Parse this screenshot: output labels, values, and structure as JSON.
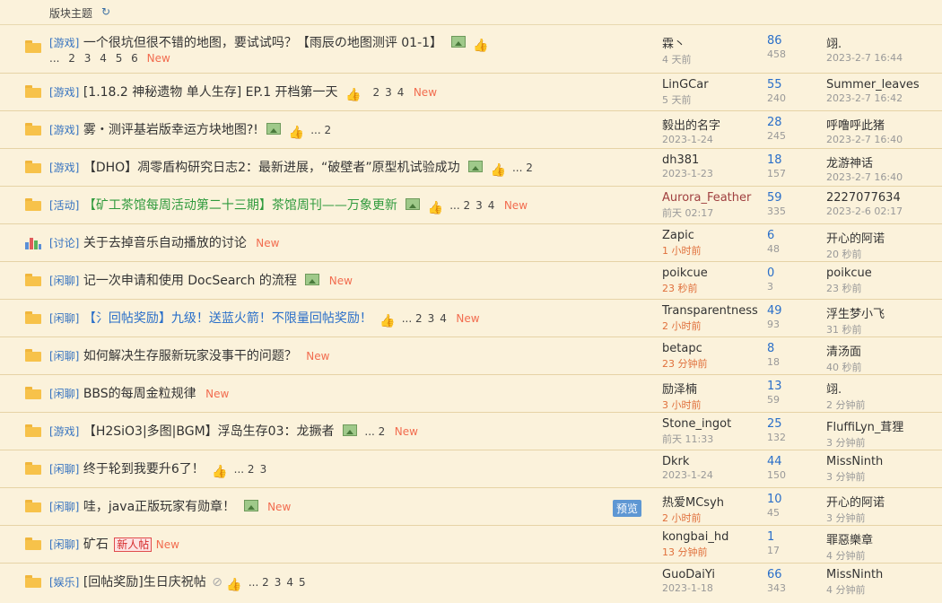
{
  "header": {
    "title": "版块主题",
    "refresh_icon": "refresh-icon"
  },
  "colors": {
    "category": "#3673c0",
    "new": "#f26c4f",
    "replies": "#2a6fc9",
    "hot_time": "#e0703c",
    "green_title": "#2f9a3c",
    "blue_title": "#2a6fc9"
  },
  "threads": [
    {
      "category": "[游戏]",
      "title": "一个很坑但很不错的地图，要试试吗？【雨辰の地图测评 01-1】",
      "pages": [
        "...",
        "2",
        "3",
        "4",
        "5",
        "6"
      ],
      "new": "New",
      "author": "霖丶",
      "author_time": "4 天前",
      "replies": "86",
      "views": "458",
      "last_user": "翊.",
      "last_time": "2023-2-7 16:44"
    },
    {
      "category": "[游戏]",
      "title": "[1.18.2 神秘遗物 单人生存] EP.1 开档第一天",
      "pages": [
        "2",
        "3",
        "4"
      ],
      "new": "New",
      "author": "LinGCar",
      "author_time": "5 天前",
      "replies": "55",
      "views": "240",
      "last_user": "Summer_leaves",
      "last_time": "2023-2-7 16:42"
    },
    {
      "category": "[游戏]",
      "title": "雾・测评基岩版幸运方块地图?!",
      "pages": [
        "2"
      ],
      "new": "",
      "author": "毅出的名字",
      "author_time": "2023-1-24",
      "replies": "28",
      "views": "245",
      "last_user": "呼噜呼此猪",
      "last_time": "2023-2-7 16:40"
    },
    {
      "category": "[游戏]",
      "title": "【DHO】凋零盾构研究日志2：最新进展，“破壁者”原型机试验成功",
      "pages": [
        "2"
      ],
      "new": "",
      "author": "dh381",
      "author_time": "2023-1-23",
      "replies": "18",
      "views": "157",
      "last_user": "龙游神话",
      "last_time": "2023-2-7 16:40"
    },
    {
      "category": "[活动]",
      "title": "【矿工茶馆每周活动第二十三期】茶馆周刊——万象更新",
      "pages": [
        "2",
        "3",
        "4"
      ],
      "new": "New",
      "author": "Aurora_Feather",
      "author_time": "前天 02:17",
      "replies": "59",
      "views": "335",
      "last_user": "2227077634",
      "last_time": "2023-2-6 02:17"
    },
    {
      "category": "[讨论]",
      "title": "关于去掉音乐自动播放的讨论",
      "pages": [],
      "new": "New",
      "author": "Zapic",
      "author_time": "1 小时前",
      "replies": "6",
      "views": "48",
      "last_user": "开心的阿诺",
      "last_time": "20 秒前"
    },
    {
      "category": "[闲聊]",
      "title": "记一次申请和使用 DocSearch 的流程",
      "pages": [],
      "new": "New",
      "author": "poikcue",
      "author_time": "23 秒前",
      "replies": "0",
      "views": "3",
      "last_user": "poikcue",
      "last_time": "23 秒前"
    },
    {
      "category": "[闲聊]",
      "title": "【氵回帖奖励】九级！送蓝火箭！不限量回帖奖励！",
      "pages": [
        "2",
        "3",
        "4"
      ],
      "new": "New",
      "author": "Transparentness",
      "author_time": "2 小时前",
      "replies": "49",
      "views": "93",
      "last_user": "浮生梦小飞",
      "last_time": "31 秒前"
    },
    {
      "category": "[闲聊]",
      "title": "如何解决生存服新玩家没事干的问题？",
      "pages": [],
      "new": "New",
      "author": "betapc",
      "author_time": "23 分钟前",
      "replies": "8",
      "views": "18",
      "last_user": "清汤面",
      "last_time": "40 秒前"
    },
    {
      "category": "[闲聊]",
      "title": "BBS的每周金粒规律",
      "pages": [],
      "new": "New",
      "author": "励泽楠",
      "author_time": "3 小时前",
      "replies": "13",
      "views": "59",
      "last_user": "翊.",
      "last_time": "2 分钟前"
    },
    {
      "category": "[游戏]",
      "title": "【H2SiO3|多图|BGM】浮岛生存03：龙撅者",
      "pages": [
        "2"
      ],
      "new": "New",
      "author": "Stone_ingot",
      "author_time": "前天 11:33",
      "replies": "25",
      "views": "132",
      "last_user": "FluffiLyn_茸狸",
      "last_time": "3 分钟前"
    },
    {
      "category": "[闲聊]",
      "title": "终于轮到我要升6了！",
      "pages": [
        "2",
        "3"
      ],
      "new": "",
      "author": "Dkrk",
      "author_time": "2023-1-24",
      "replies": "44",
      "views": "150",
      "last_user": "MissNinth",
      "last_time": "3 分钟前"
    },
    {
      "category": "[闲聊]",
      "title": "哇，java正版玩家有勋章！",
      "pages": [],
      "new": "New",
      "preview": "预览",
      "author": "热爱MCsyh",
      "author_time": "2 小时前",
      "replies": "10",
      "views": "45",
      "last_user": "开心的阿诺",
      "last_time": "3 分钟前"
    },
    {
      "category": "[闲聊]",
      "title": "矿石",
      "newbie": "新人帖",
      "pages": [],
      "new": "New",
      "author": "kongbai_hd",
      "author_time": "13 分钟前",
      "replies": "1",
      "views": "17",
      "last_user": "罪惡樂章",
      "last_time": "4 分钟前"
    },
    {
      "category": "[娱乐]",
      "title": "[回帖奖励]生日庆祝帖",
      "pages": [
        "2",
        "3",
        "4",
        "5"
      ],
      "new": "",
      "author": "GuoDaiYi",
      "author_time": "2023-1-18",
      "replies": "66",
      "views": "343",
      "last_user": "MissNinth",
      "last_time": "4 分钟前"
    }
  ]
}
